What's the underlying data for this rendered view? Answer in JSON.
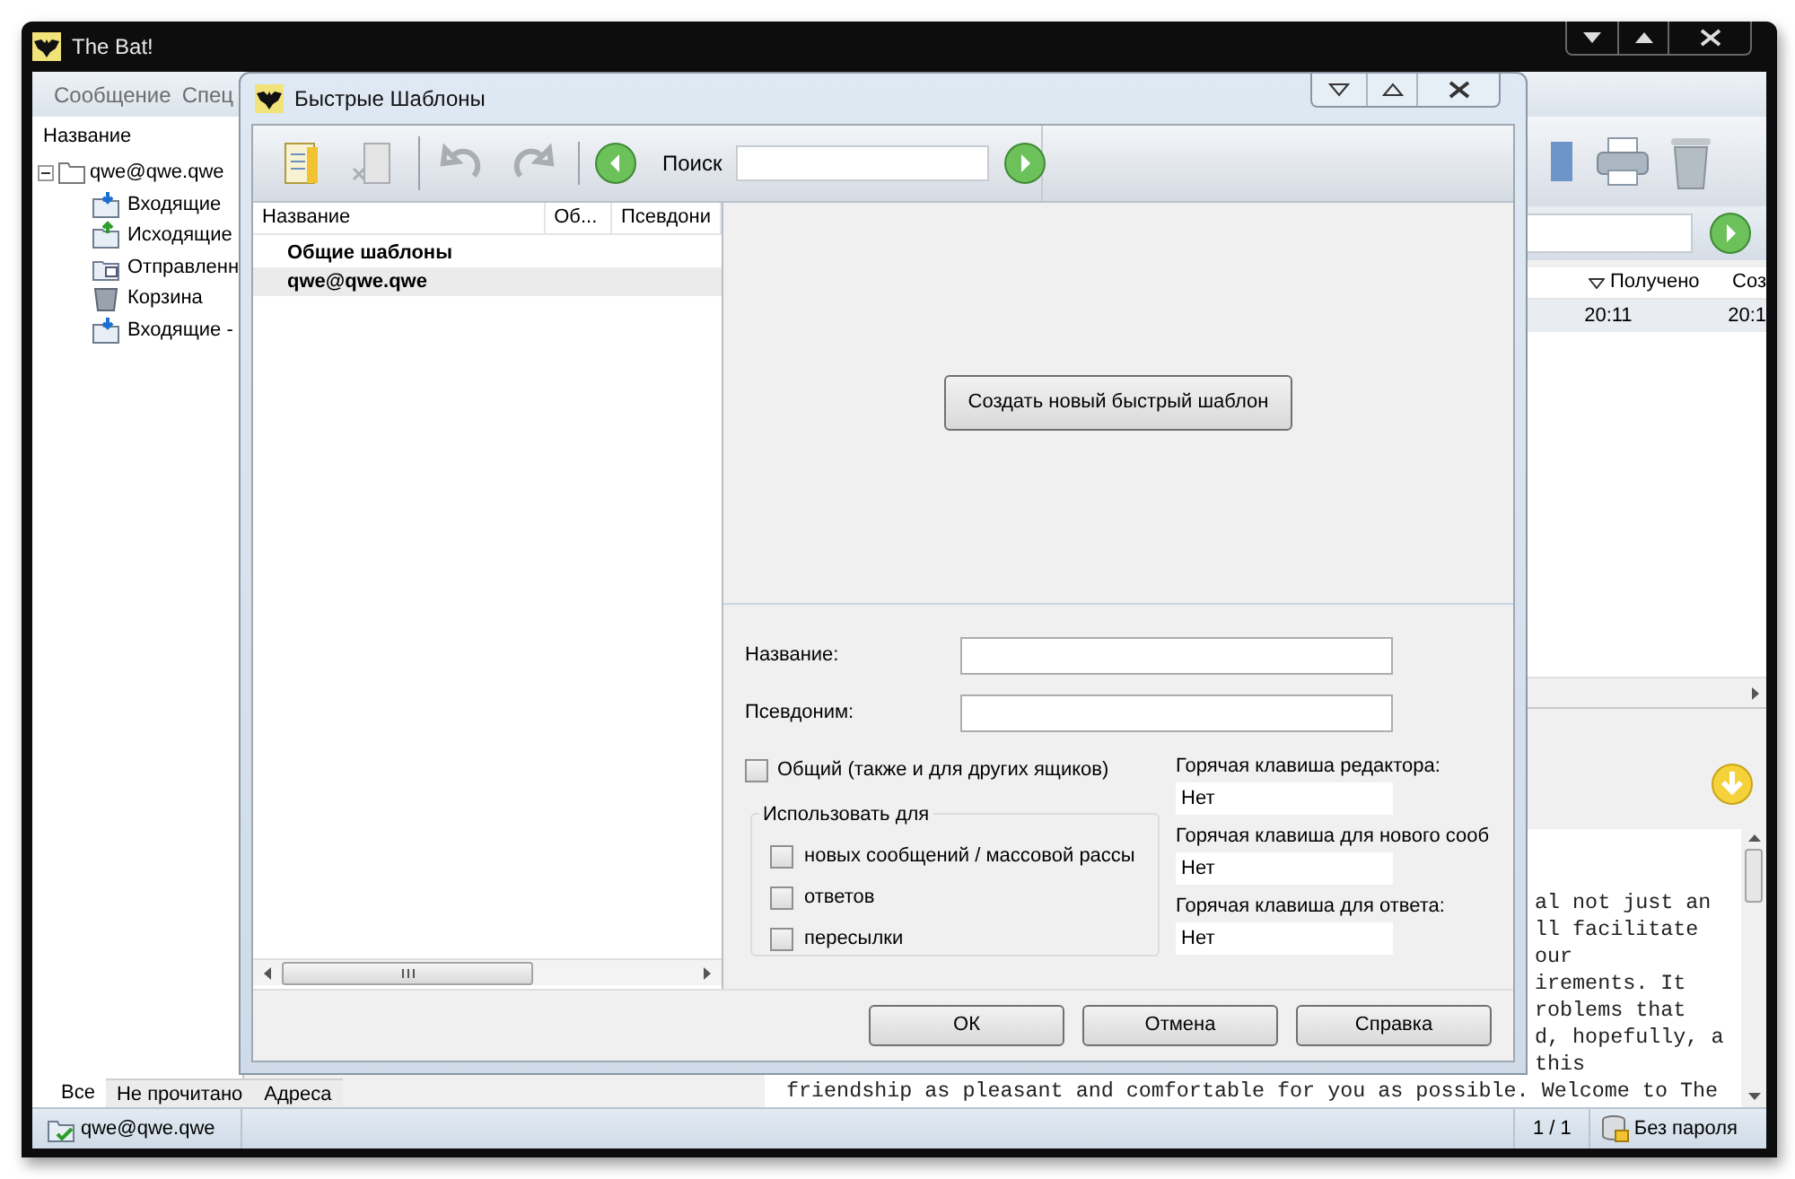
{
  "main_window": {
    "title": "The Bat!",
    "menu": [
      "Сообщение",
      "Спец"
    ],
    "folders": {
      "header": "Название",
      "account": {
        "label": "qwe@qwe.qwe",
        "expanded": true,
        "children": [
          {
            "label": "Входящие",
            "kind": "inbox"
          },
          {
            "label": "Исходящие",
            "kind": "outbox"
          },
          {
            "label": "Отправленн",
            "kind": "sent"
          },
          {
            "label": "Корзина",
            "kind": "trash"
          },
          {
            "label": "Входящие -",
            "kind": "inbox"
          }
        ]
      }
    },
    "message_list": {
      "columns": [
        {
          "label": "Получено",
          "sorted": true
        },
        {
          "label": "Соз",
          "sorted": false
        }
      ],
      "rows": [
        [
          "20:11",
          "20:1"
        ]
      ]
    },
    "preview": {
      "right_fragments": [
        "al not just an",
        "ll facilitate",
        "our",
        "irements. It",
        "roblems that",
        "d, hopefully, a",
        "this"
      ],
      "bottom_line": "friendship as pleasant and comfortable for you as possible. Welcome to The"
    },
    "folder_tabs": [
      {
        "label": "Все",
        "selected": true
      },
      {
        "label": "Не прочитано",
        "selected": false
      },
      {
        "label": "Адреса",
        "selected": false
      }
    ],
    "status_bar": {
      "account": "qwe@qwe.qwe",
      "count": "1 / 1",
      "security": "Без пароля"
    }
  },
  "dialog": {
    "title": "Быстрые Шаблоны",
    "toolbar": [
      {
        "kind": "new",
        "disabled": false
      },
      {
        "kind": "delete",
        "disabled": true
      },
      {
        "kind": "undo",
        "disabled": true
      },
      {
        "kind": "redo",
        "disabled": true
      }
    ],
    "search_label": "Поиск",
    "list": {
      "columns": [
        "Название",
        "Об...",
        "Псевдони"
      ],
      "rows": [
        {
          "label": "Общие шаблоны",
          "selected": false
        },
        {
          "label": "qwe@qwe.qwe",
          "selected": true
        }
      ]
    },
    "create_button": "Создать новый быстрый шаблон",
    "name_label": "Название:",
    "alias_label": "Псевдоним:",
    "shared": {
      "label": "Общий (также и для других ящиков)",
      "checked": false
    },
    "use_for": {
      "title": "Использовать для",
      "options": [
        {
          "label": "новых сообщений / массовой рассы",
          "checked": false
        },
        {
          "label": "ответов",
          "checked": false
        },
        {
          "label": "пересылки",
          "checked": false
        }
      ]
    },
    "hotkeys": [
      {
        "label": "Горячая клавиша редактора:",
        "value": "Нет"
      },
      {
        "label": "Горячая клавиша для нового сооб",
        "value": "Нет"
      },
      {
        "label": "Горячая клавиша для ответа:",
        "value": "Нет"
      }
    ],
    "buttons": [
      "ОК",
      "Отмена",
      "Справка"
    ]
  }
}
